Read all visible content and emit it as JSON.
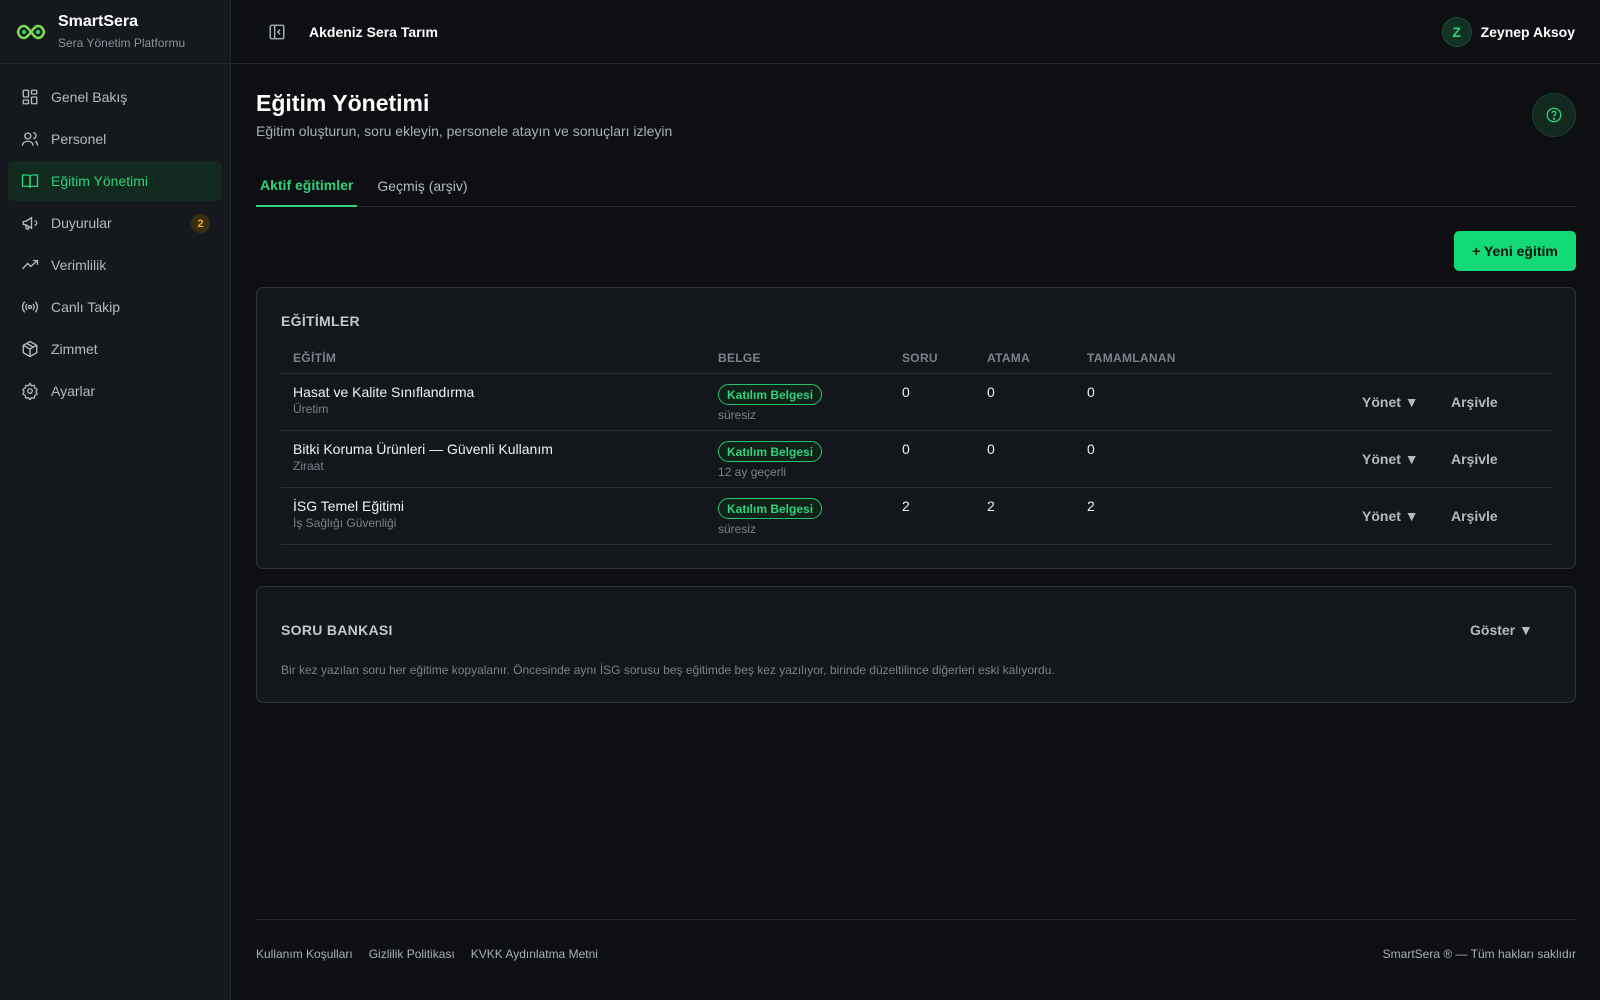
{
  "brand": {
    "name": "SmartSera",
    "subtitle": "Sera Yönetim Platformu"
  },
  "sidebar": {
    "items": [
      {
        "label": "Genel Bakış",
        "icon": "grid-icon",
        "active": false
      },
      {
        "label": "Personel",
        "icon": "users-icon",
        "active": false
      },
      {
        "label": "Eğitim Yönetimi",
        "icon": "book-open-icon",
        "active": true
      },
      {
        "label": "Duyurular",
        "icon": "megaphone-icon",
        "active": false,
        "badge": "2"
      },
      {
        "label": "Verimlilik",
        "icon": "trending-up-icon",
        "active": false
      },
      {
        "label": "Canlı Takip",
        "icon": "broadcast-icon",
        "active": false
      },
      {
        "label": "Zimmet",
        "icon": "package-icon",
        "active": false
      },
      {
        "label": "Ayarlar",
        "icon": "gear-icon",
        "active": false
      }
    ]
  },
  "topbar": {
    "company": "Akdeniz Sera Tarım",
    "user_initial": "Z",
    "user_name": "Zeynep Aksoy"
  },
  "page": {
    "title": "Eğitim Yönetimi",
    "subtitle": "Eğitim oluşturun, soru ekleyin, personele atayın ve sonuçları izleyin",
    "tabs": [
      {
        "label": "Aktif eğitimler",
        "active": true
      },
      {
        "label": "Geçmiş (arşiv)",
        "active": false
      }
    ],
    "new_button": "+ Yeni eğitim"
  },
  "trainings": {
    "title": "EĞİTİMLER",
    "columns": [
      "EĞİTİM",
      "BELGE",
      "SORU",
      "ATAMA",
      "TAMAMLANAN"
    ],
    "rows": [
      {
        "name": "Hasat ve Kalite Sınıflandırma",
        "category": "Üretim",
        "certificate": "Katılım Belgesi",
        "validity": "süresiz",
        "questions": "0",
        "assigned": "0",
        "completed": "0"
      },
      {
        "name": "Bitki Koruma Ürünleri — Güvenli Kullanım",
        "category": "Ziraat",
        "certificate": "Katılım Belgesi",
        "validity": "12 ay geçerli",
        "questions": "0",
        "assigned": "0",
        "completed": "0"
      },
      {
        "name": "İSG Temel Eğitimi",
        "category": "İş Sağlığı Güvenliği",
        "certificate": "Katılım Belgesi",
        "validity": "süresiz",
        "questions": "2",
        "assigned": "2",
        "completed": "2"
      }
    ],
    "manage_label": "Yönet ▼",
    "archive_label": "Arşivle"
  },
  "question_bank": {
    "title": "SORU BANKASI",
    "toggle_label": "Göster ▼",
    "description": "Bir kez yazılan soru her eğitime kopyalanır. Öncesinde aynı İSG sorusu beş eğitimde beş kez yazılıyor, birinde düzeltilince diğerleri eski kalıyordu."
  },
  "footer": {
    "links": [
      "Kullanım Koşulları",
      "Gizlilik Politikası",
      "KVKK Aydınlatma Metni"
    ],
    "copyright": "SmartSera ® — Tüm hakları saklıdır"
  },
  "colors": {
    "accent": "#2fd27a",
    "button": "#13d977",
    "badge_warning": "#f0a93a",
    "background": "#0d0f12"
  }
}
